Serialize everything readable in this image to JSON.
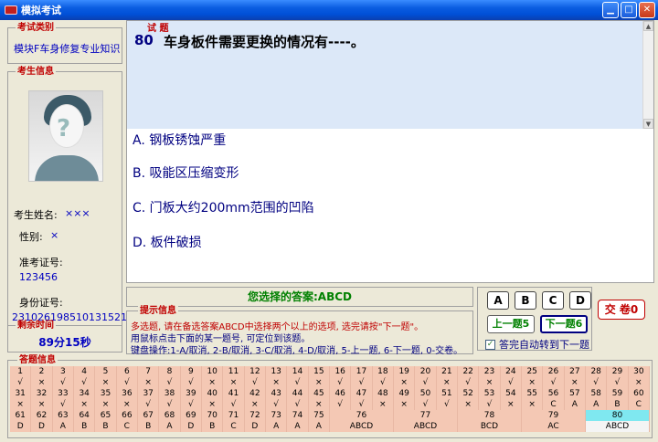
{
  "window": {
    "title": "模拟考试"
  },
  "exam_type": {
    "legend": "考试类别",
    "value": "模块F车身修复专业知识"
  },
  "examinee": {
    "legend": "考生信息",
    "name_label": "考生姓名:",
    "name": "×××",
    "gender_label": "性别:",
    "gender": "×",
    "ticket_label": "准考证号:",
    "ticket": "123456",
    "id_label": "身份证号:",
    "id": "231026198510131521"
  },
  "remaining": {
    "legend": "剩余时间",
    "value": "89分15秒"
  },
  "question": {
    "legend": "试 题",
    "number": "80",
    "text": "车身板件需要更换的情况有----。",
    "options": [
      "A. 钢板锈蚀严重",
      "B. 吸能区压缩变形",
      "C. 门板大约200mm范围的凹陷",
      "D. 板件破损"
    ]
  },
  "answer": {
    "text": "您选择的答案:ABCD"
  },
  "hint": {
    "legend": "提示信息",
    "line1": "多选题, 请在备选答案ABCD中选择两个以上的选项, 选完请按\"下一题\"。",
    "line2": "用鼠标点击下面的某一题号, 可定位到该题。",
    "line3": "键盘操作:1-A/取消, 2-B/取消, 3-C/取消, 4-D/取消, 5-上一题, 6-下一题, 0-交卷。"
  },
  "controls": {
    "a": "A",
    "b": "B",
    "c": "C",
    "d": "D",
    "prev": "上一题5",
    "next": "下一题6",
    "auto_next": "答完自动转到下一题",
    "submit": "交 卷0"
  },
  "answers_sheet": {
    "legend": "答题信息",
    "row1_nums": [
      "1",
      "2",
      "3",
      "4",
      "5",
      "6",
      "7",
      "8",
      "9",
      "10",
      "11",
      "12",
      "13",
      "14",
      "15",
      "16",
      "17",
      "18",
      "19",
      "20",
      "21",
      "22",
      "23",
      "24",
      "25",
      "26",
      "27",
      "28",
      "29",
      "30"
    ],
    "row1_ans": [
      "√",
      "×",
      "√",
      "√",
      "×",
      "√",
      "×",
      "√",
      "√",
      "×",
      "×",
      "√",
      "×",
      "√",
      "×",
      "√",
      "√",
      "√",
      "×",
      "√",
      "×",
      "√",
      "×",
      "√",
      "×",
      "√",
      "×",
      "√",
      "√",
      "×"
    ],
    "row2_nums": [
      "31",
      "32",
      "33",
      "34",
      "35",
      "36",
      "37",
      "38",
      "39",
      "40",
      "41",
      "42",
      "43",
      "44",
      "45",
      "46",
      "47",
      "48",
      "49",
      "50",
      "51",
      "52",
      "53",
      "54",
      "55",
      "56",
      "57",
      "58",
      "59",
      "60"
    ],
    "row2_ans": [
      "×",
      "×",
      "√",
      "×",
      "×",
      "×",
      "√",
      "√",
      "√",
      "×",
      "√",
      "×",
      "√",
      "√",
      "×",
      "√",
      "√",
      "×",
      "×",
      "√",
      "√",
      "×",
      "√",
      "×",
      "×",
      "C",
      "A",
      "A",
      "B",
      "C"
    ],
    "row3_nums": [
      "61",
      "62",
      "63",
      "64",
      "65",
      "66",
      "67",
      "68",
      "69",
      "70",
      "71",
      "72",
      "73",
      "74",
      "75"
    ],
    "row3_ans": [
      "D",
      "D",
      "A",
      "B",
      "B",
      "C",
      "B",
      "A",
      "D",
      "B",
      "C",
      "D",
      "A",
      "A",
      "A"
    ],
    "row3_multi": [
      {
        "num": "76",
        "ans": "ABCD"
      },
      {
        "num": "77",
        "ans": "ABCD"
      },
      {
        "num": "78",
        "ans": "BCD"
      },
      {
        "num": "79",
        "ans": "AC"
      },
      {
        "num": "80",
        "ans": "ABCD"
      }
    ]
  }
}
